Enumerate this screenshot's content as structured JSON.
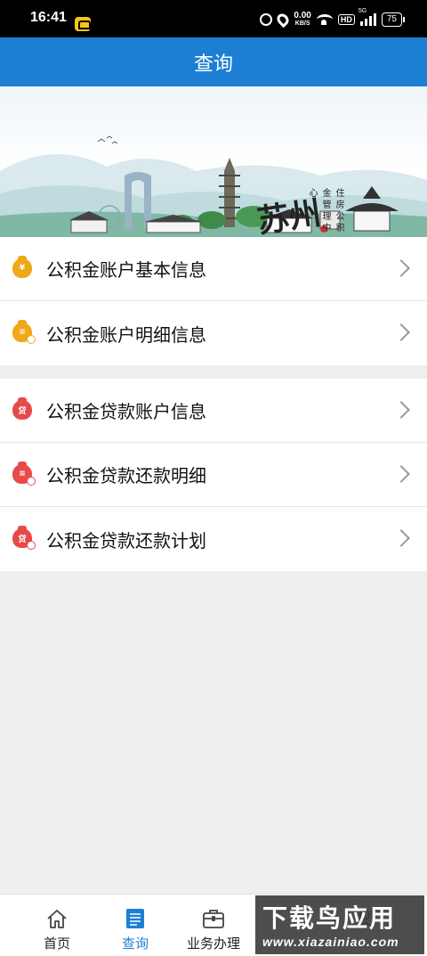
{
  "status_bar": {
    "time": "16:41",
    "net_speed": "0.00",
    "net_unit": "KB/S",
    "hd": "HD",
    "network": "5G",
    "battery": "75"
  },
  "header": {
    "title": "查询"
  },
  "banner": {
    "city": "苏州",
    "org": "住房公积金管理中心"
  },
  "groups": [
    {
      "items": [
        {
          "label": "公积金账户基本信息",
          "icon": "coin-bag-icon",
          "icon_text": "¥",
          "color": "#f0a818"
        },
        {
          "label": "公积金账户明细信息",
          "icon": "coin-list-icon",
          "icon_text": "≡",
          "color": "#f0a818"
        }
      ]
    },
    {
      "items": [
        {
          "label": "公积金贷款账户信息",
          "icon": "loan-bag-icon",
          "icon_text": "贷",
          "color": "#e84a4a"
        },
        {
          "label": "公积金贷款还款明细",
          "icon": "loan-list-icon",
          "icon_text": "≡",
          "color": "#e84a4a"
        },
        {
          "label": "公积金贷款还款计划",
          "icon": "loan-plan-icon",
          "icon_text": "贷",
          "color": "#e84a4a"
        }
      ]
    }
  ],
  "tabbar": {
    "tabs": [
      {
        "label": "首页",
        "icon": "home-icon"
      },
      {
        "label": "查询",
        "icon": "query-icon",
        "active": true
      },
      {
        "label": "业务办理",
        "icon": "briefcase-icon"
      },
      {
        "label": "",
        "icon": "profile-icon"
      }
    ]
  },
  "watermark": {
    "title": "下载鸟应用",
    "url": "www.xiazainiao.com"
  }
}
